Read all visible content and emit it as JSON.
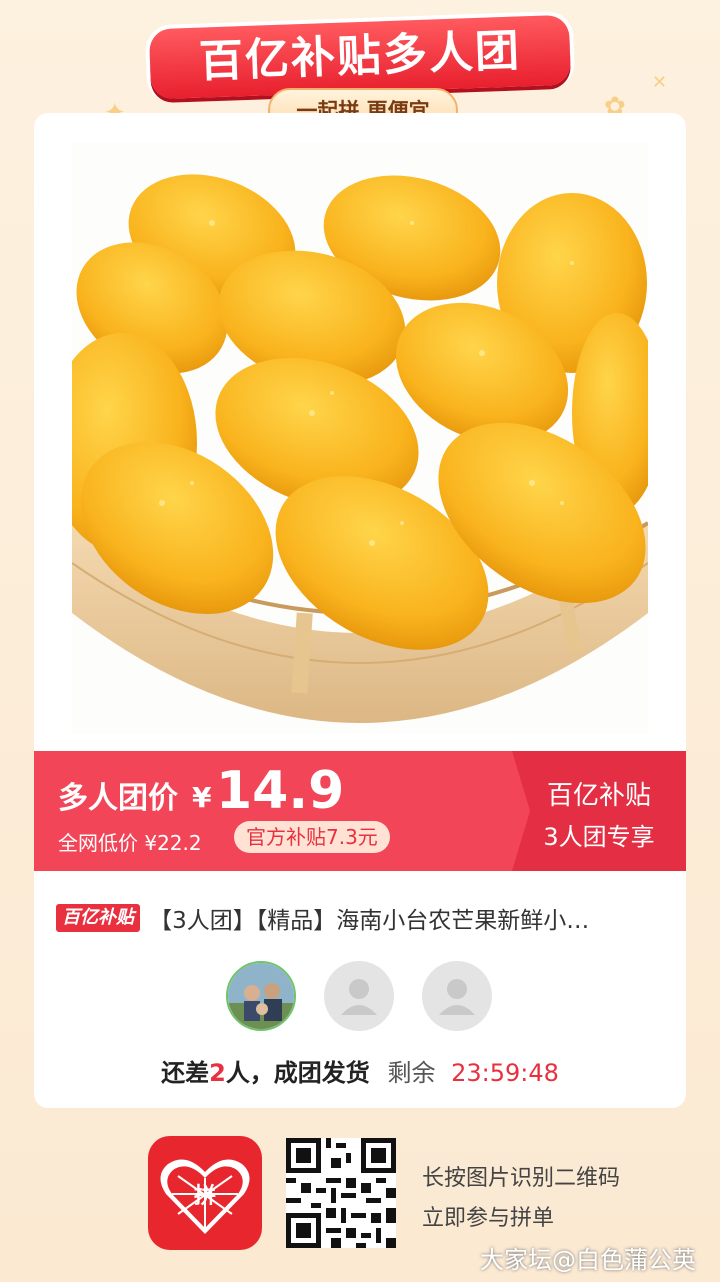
{
  "banner": {
    "title": "百亿补贴多人团",
    "subtitle": "一起拼 更便宜"
  },
  "price": {
    "label": "多人团价",
    "currency": "¥",
    "value": "14.9",
    "market_label": "全网低价 ¥22.2",
    "subsidy_badge": "官方补贴7.3元",
    "side_line1": "百亿补贴",
    "side_line2": "3人团专享"
  },
  "product": {
    "tag": "百亿补贴",
    "title": "【3人团】【精品】海南小台农芒果新鲜小…"
  },
  "group": {
    "status_prefix": "还差",
    "missing_count": "2",
    "status_suffix": "人，成团发货",
    "remaining_label": "剩余",
    "countdown": "23:59:48"
  },
  "footer": {
    "line1": "长按图片识别二维码",
    "line2": "立即参与拼单",
    "app_logo_text": "拼"
  },
  "watermark": "大家坛@白色蒲公英",
  "colors": {
    "accent": "#e8303f",
    "price_bar": "#f24658",
    "background": "#fdf1df"
  }
}
